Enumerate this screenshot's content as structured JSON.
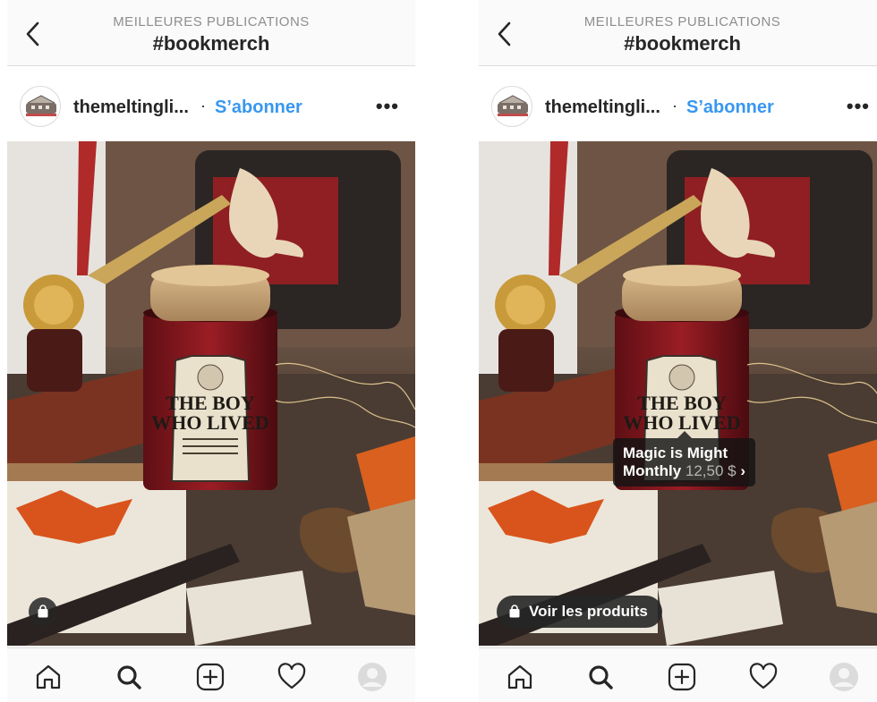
{
  "screens": [
    {
      "header": {
        "subtitle": "MEILLEURES PUBLICATIONS",
        "title": "#bookmerch"
      },
      "post": {
        "username": "themeltingli...",
        "separator": "·",
        "follow_label": "S’abonner",
        "more_label": "•••"
      },
      "shop": {
        "icon": "shopping-bag-icon"
      },
      "nav": [
        "home-icon",
        "search-icon",
        "add-post-icon",
        "heart-icon",
        "profile-avatar"
      ]
    },
    {
      "header": {
        "subtitle": "MEILLEURES PUBLICATIONS",
        "title": "#bookmerch"
      },
      "post": {
        "username": "themeltingli...",
        "separator": "·",
        "follow_label": "S’abonner",
        "more_label": "•••"
      },
      "product_tag": {
        "name_line1": "Magic is Might",
        "name_line2": "Monthly",
        "price": "12,50 $",
        "chevron": "›"
      },
      "shop": {
        "icon": "shopping-bag-icon",
        "label": "Voir les produits"
      },
      "nav": [
        "home-icon",
        "search-icon",
        "add-post-icon",
        "heart-icon",
        "profile-avatar"
      ]
    }
  ],
  "photo_text": {
    "label_line1": "THE BOY",
    "label_line2": "WHO LIVED"
  },
  "colors": {
    "link": "#3897f0",
    "text": "#262626",
    "muted": "#8e8e8e",
    "border": "#dbdbdb"
  }
}
